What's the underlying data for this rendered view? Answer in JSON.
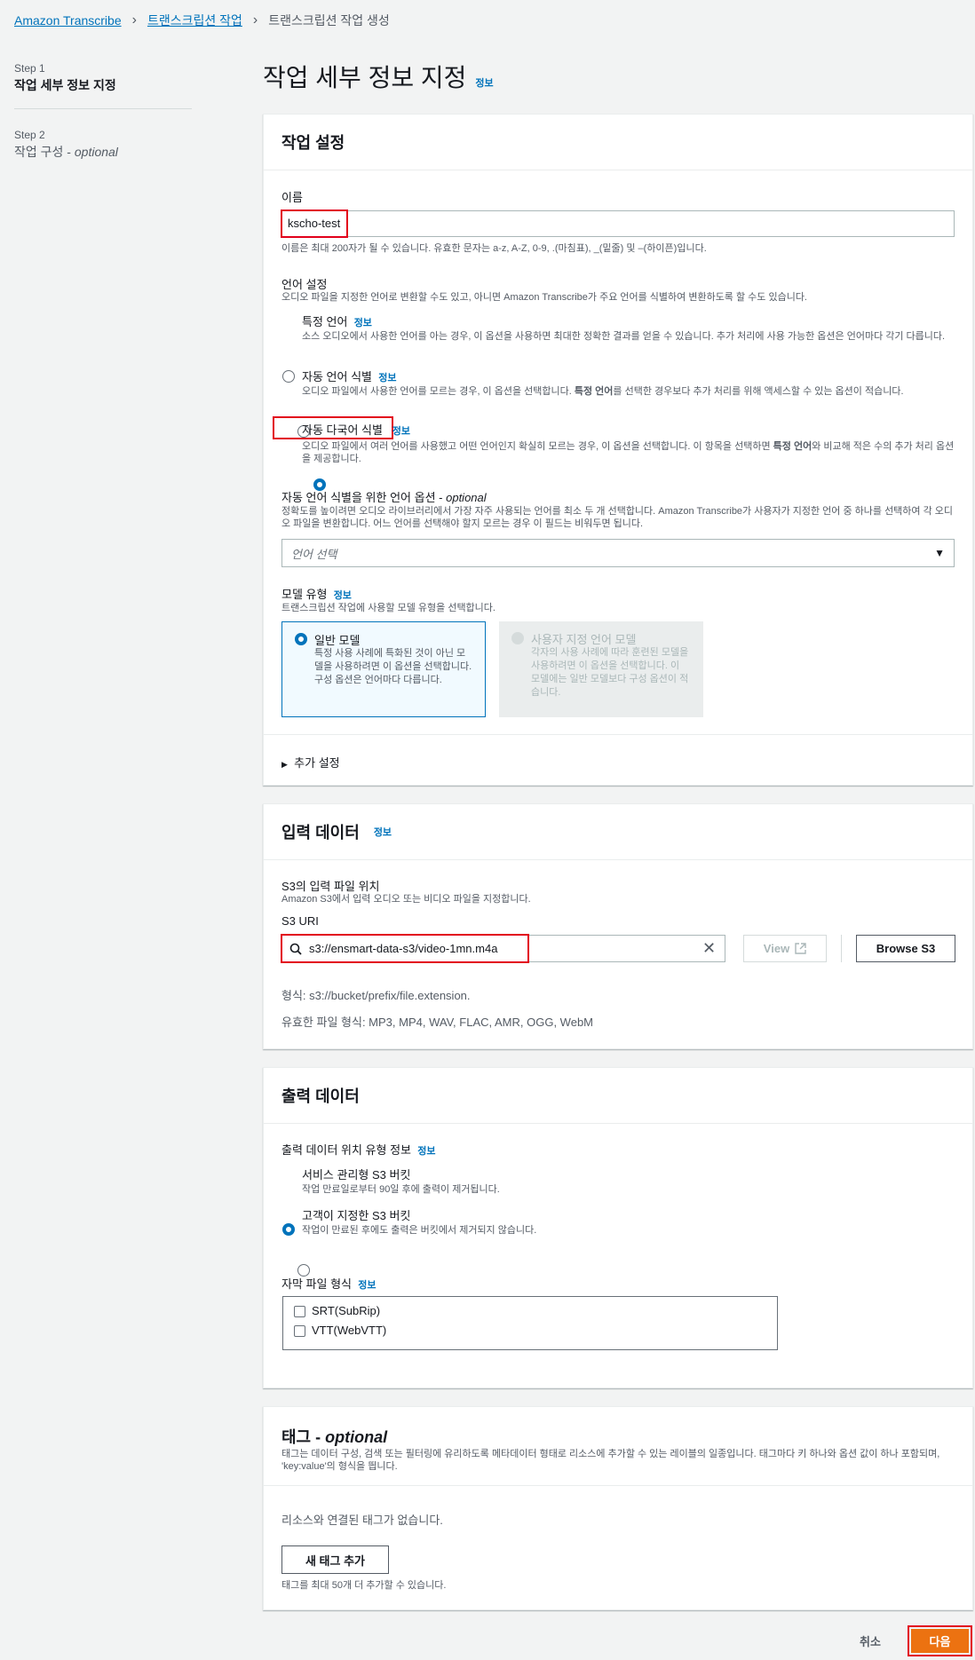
{
  "breadcrumb": {
    "item1": "Amazon Transcribe",
    "item2": "트랜스크립션 작업",
    "current": "트랜스크립션 작업 생성"
  },
  "steps": {
    "step1_num": "Step 1",
    "step1_title": "작업 세부 정보 지정",
    "step2_num": "Step 2",
    "step2_title": "작업 구성",
    "step2_optional": "optional"
  },
  "page": {
    "title": "작업 세부 정보 지정",
    "info": "정보"
  },
  "job_settings": {
    "header": "작업 설정",
    "name_label": "이름",
    "name_value": "kscho-test",
    "name_hint": "이름은 최대 200자가 될 수 있습니다. 유효한 문자는 a-z, A-Z, 0-9, .(마침표), _(밑줄) 및 –(하이픈)입니다.",
    "lang_label": "언어 설정",
    "lang_desc": "오디오 파일을 지정한 언어로 변환할 수도 있고, 아니면 Amazon Transcribe가 주요 언어를 식별하여 변환하도록 할 수도 있습니다.",
    "options": [
      {
        "label": "특정 언어",
        "info": "정보",
        "desc": "소스 오디오에서 사용한 언어를 아는 경우, 이 옵션을 사용하면 최대한 정확한 결과를 얻을 수 있습니다. 추가 처리에 사용 가능한 옵션은 언어마다 각기 다릅니다."
      },
      {
        "label": "자동 언어 식별",
        "info": "정보",
        "desc_a": "오디오 파일에서 사용한 언어를 모르는 경우, 이 옵션을 선택합니다. ",
        "desc_b": "특정 언어",
        "desc_c": "를 선택한 경우보다 추가 처리를 위해 액세스할 수 있는 옵션이 적습니다."
      },
      {
        "label": "자동 다국어 식별",
        "info": "정보",
        "desc_a": "오디오 파일에서 여러 언어를 사용했고 어떤 언어인지 확실히 모르는 경우, 이 옵션을 선택합니다. 이 항목을 선택하면 ",
        "desc_b": "특정 언어",
        "desc_c": "와 비교해 적은 수의 추가 처리 옵션을 제공합니다."
      }
    ],
    "lang_opt_label": "자동 언어 식별을 위한 언어 옵션",
    "optional": "optional",
    "lang_opt_desc": "정확도를 높이려면 오디오 라이브러리에서 가장 자주 사용되는 언어를 최소 두 개 선택합니다. Amazon Transcribe가 사용자가 지정한 언어 중 하나를 선택하여 각 오디오 파일을 변환합니다. 어느 언어를 선택해야 할지 모르는 경우 이 필드는 비워두면 됩니다.",
    "lang_select_placeholder": "언어 선택",
    "model_label": "모델 유형",
    "model_info": "정보",
    "model_desc": "트랜스크립션 작업에 사용할 모델 유형을 선택합니다.",
    "model_general_title": "일반 모델",
    "model_general_desc": "특정 사용 사례에 특화된 것이 아닌 모델을 사용하려면 이 옵션을 선택합니다. 구성 옵션은 언어마다 다릅니다.",
    "model_custom_title": "사용자 지정 언어 모델",
    "model_custom_desc": "각자의 사용 사례에 따라 훈련된 모델을 사용하려면 이 옵션을 선택합니다. 이 모델에는 일반 모델보다 구성 옵션이 적습니다.",
    "additional": "추가 설정"
  },
  "input": {
    "header": "입력 데이터",
    "info": "정보",
    "loc_label": "S3의 입력 파일 위치",
    "loc_desc": "Amazon S3에서 입력 오디오 또는 비디오 파일을 지정합니다.",
    "uri_label": "S3 URI",
    "uri_value": "s3://ensmart-data-s3/video-1mn.m4a",
    "view_btn": "View",
    "browse_btn": "Browse S3",
    "format_hint": "형식: s3://bucket/prefix/file.extension.",
    "valid_formats": "유효한 파일 형식: MP3, MP4, WAV, FLAC, AMR, OGG, WebM"
  },
  "output": {
    "header": "출력 데이터",
    "loc_label": "출력 데이터 위치 유형 정보",
    "info": "정보",
    "opt1_label": "서비스 관리형 S3 버킷",
    "opt1_desc": "작업 만료일로부터 90일 후에 출력이 제거됩니다.",
    "opt2_label": "고객이 지정한 S3 버킷",
    "opt2_desc": "작업이 만료된 후에도 출력은 버킷에서 제거되지 않습니다.",
    "subtitle_label": "자막 파일 형식",
    "subtitle_info": "정보",
    "srt": "SRT(SubRip)",
    "vtt": "VTT(WebVTT)"
  },
  "tags": {
    "header": "태그",
    "optional": "optional",
    "desc": "태그는 데이터 구성, 검색 또는 필터링에 유리하도록 메타데이터 형태로 리소스에 추가할 수 있는 레이블의 일종입니다. 태그마다 키 하나와 옵션 값이 하나 포함되며, 'key:value'의 형식을 띕니다.",
    "none": "리소스와 연결된 태그가 없습니다.",
    "add_btn": "새 태그 추가",
    "limit": "태그를 최대 50개 더 추가할 수 있습니다."
  },
  "footer": {
    "cancel": "취소",
    "next": "다음"
  },
  "colors": {
    "accent": "#0073bb",
    "highlight": "#e2001a",
    "primary": "#ec7211"
  }
}
